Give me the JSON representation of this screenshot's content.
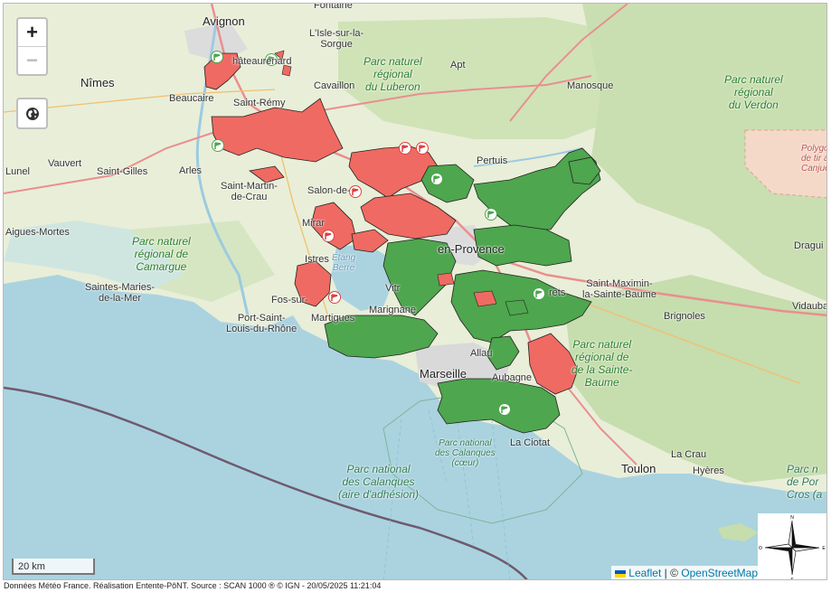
{
  "map": {
    "controls": {
      "zoom_in": "+",
      "zoom_out": "−",
      "locate_icon": "globe-icon"
    },
    "scale_label": "20 km",
    "attribution": {
      "leaflet": "Leaflet",
      "separator": " | © ",
      "osm": "OpenStreetMap"
    },
    "footer": "Données Météo France. Réalisation Entente-PôNT. Source : SCAN 1000 ® © IGN - 20/05/2025 11:21:04",
    "compass": {
      "n": "N",
      "s": "S",
      "e": "E",
      "o": "O"
    },
    "colors": {
      "sea": "#aad3df",
      "land": "#e9eed8",
      "forest": "#c8dfb0",
      "risk_red": "#ef6a62",
      "risk_green": "#4ea64e",
      "motorway": "#e98f8f",
      "urban": "#dcdcdc"
    },
    "places": {
      "fontaine": "Fontaine",
      "avignon": "Avignon",
      "isle_sur_sorgue": "L'Isle-sur-la-\nSorgue",
      "chateaurenard": "hâteaurenard",
      "nimes": "Nîmes",
      "beaucaire": "Beaucaire",
      "saint_remy": "Saint-Rémy",
      "cavaillon": "Cavaillon",
      "apt": "Apt",
      "manosque": "Manosque",
      "lunel": "Lunel",
      "vauvert": "Vauvert",
      "saint_gilles": "Saint-Gilles",
      "arles": "Arles",
      "saint_martin_de_crau": "Saint-Martin-\nde-Crau",
      "salon": "Salon-de-",
      "pertuis": "Pertuis",
      "aigues_mortes": "Aigues-Mortes",
      "miramas": "Mirar",
      "istres": "Istres",
      "aix": "en-Provence",
      "saint_maximin": "Saint-Maximin-\nla-Sainte-Baume",
      "draguignan": "Dragui",
      "saintes_maries": "Saintes-Maries-\nde-la-Mer",
      "fos": "Fos-sur-",
      "vitrolles": "Vitr",
      "trets": "rets",
      "marignane": "Marignane",
      "martigues": "Martigues",
      "port_saint_louis": "Port-Saint-\nLouis-du-Rhône",
      "brignoles": "Brignoles",
      "vidauban": "Vidauban",
      "allauch": "Allau",
      "marseille": "Marseille",
      "aubagne": "Aubagne",
      "la_ciotat": "La Ciotat",
      "toulon": "Toulon",
      "hyeres": "Hyères",
      "la_crau": "La Crau"
    },
    "parks": {
      "luberon": "Parc naturel\nrégional\ndu Luberon",
      "verdon": "Parc naturel\nrégional\ndu Verdon",
      "camargue": "Parc naturel\nrégional de\nCamargue",
      "sainte_baume": "Parc naturel\nrégional de\nde la Sainte-\nBaume",
      "calanques_adhesion": "Parc national\ndes Calanques\n(aire d'adhésion)",
      "calanques_coeur": "Parc national\ndes Calanques\n(cœur)",
      "port_cros": "Parc n\nde Por\nCros (a"
    },
    "water": {
      "etang_berre": "Étang\nBerre"
    },
    "polygon_label": "Polygo\nde tir a\nCanjue"
  }
}
